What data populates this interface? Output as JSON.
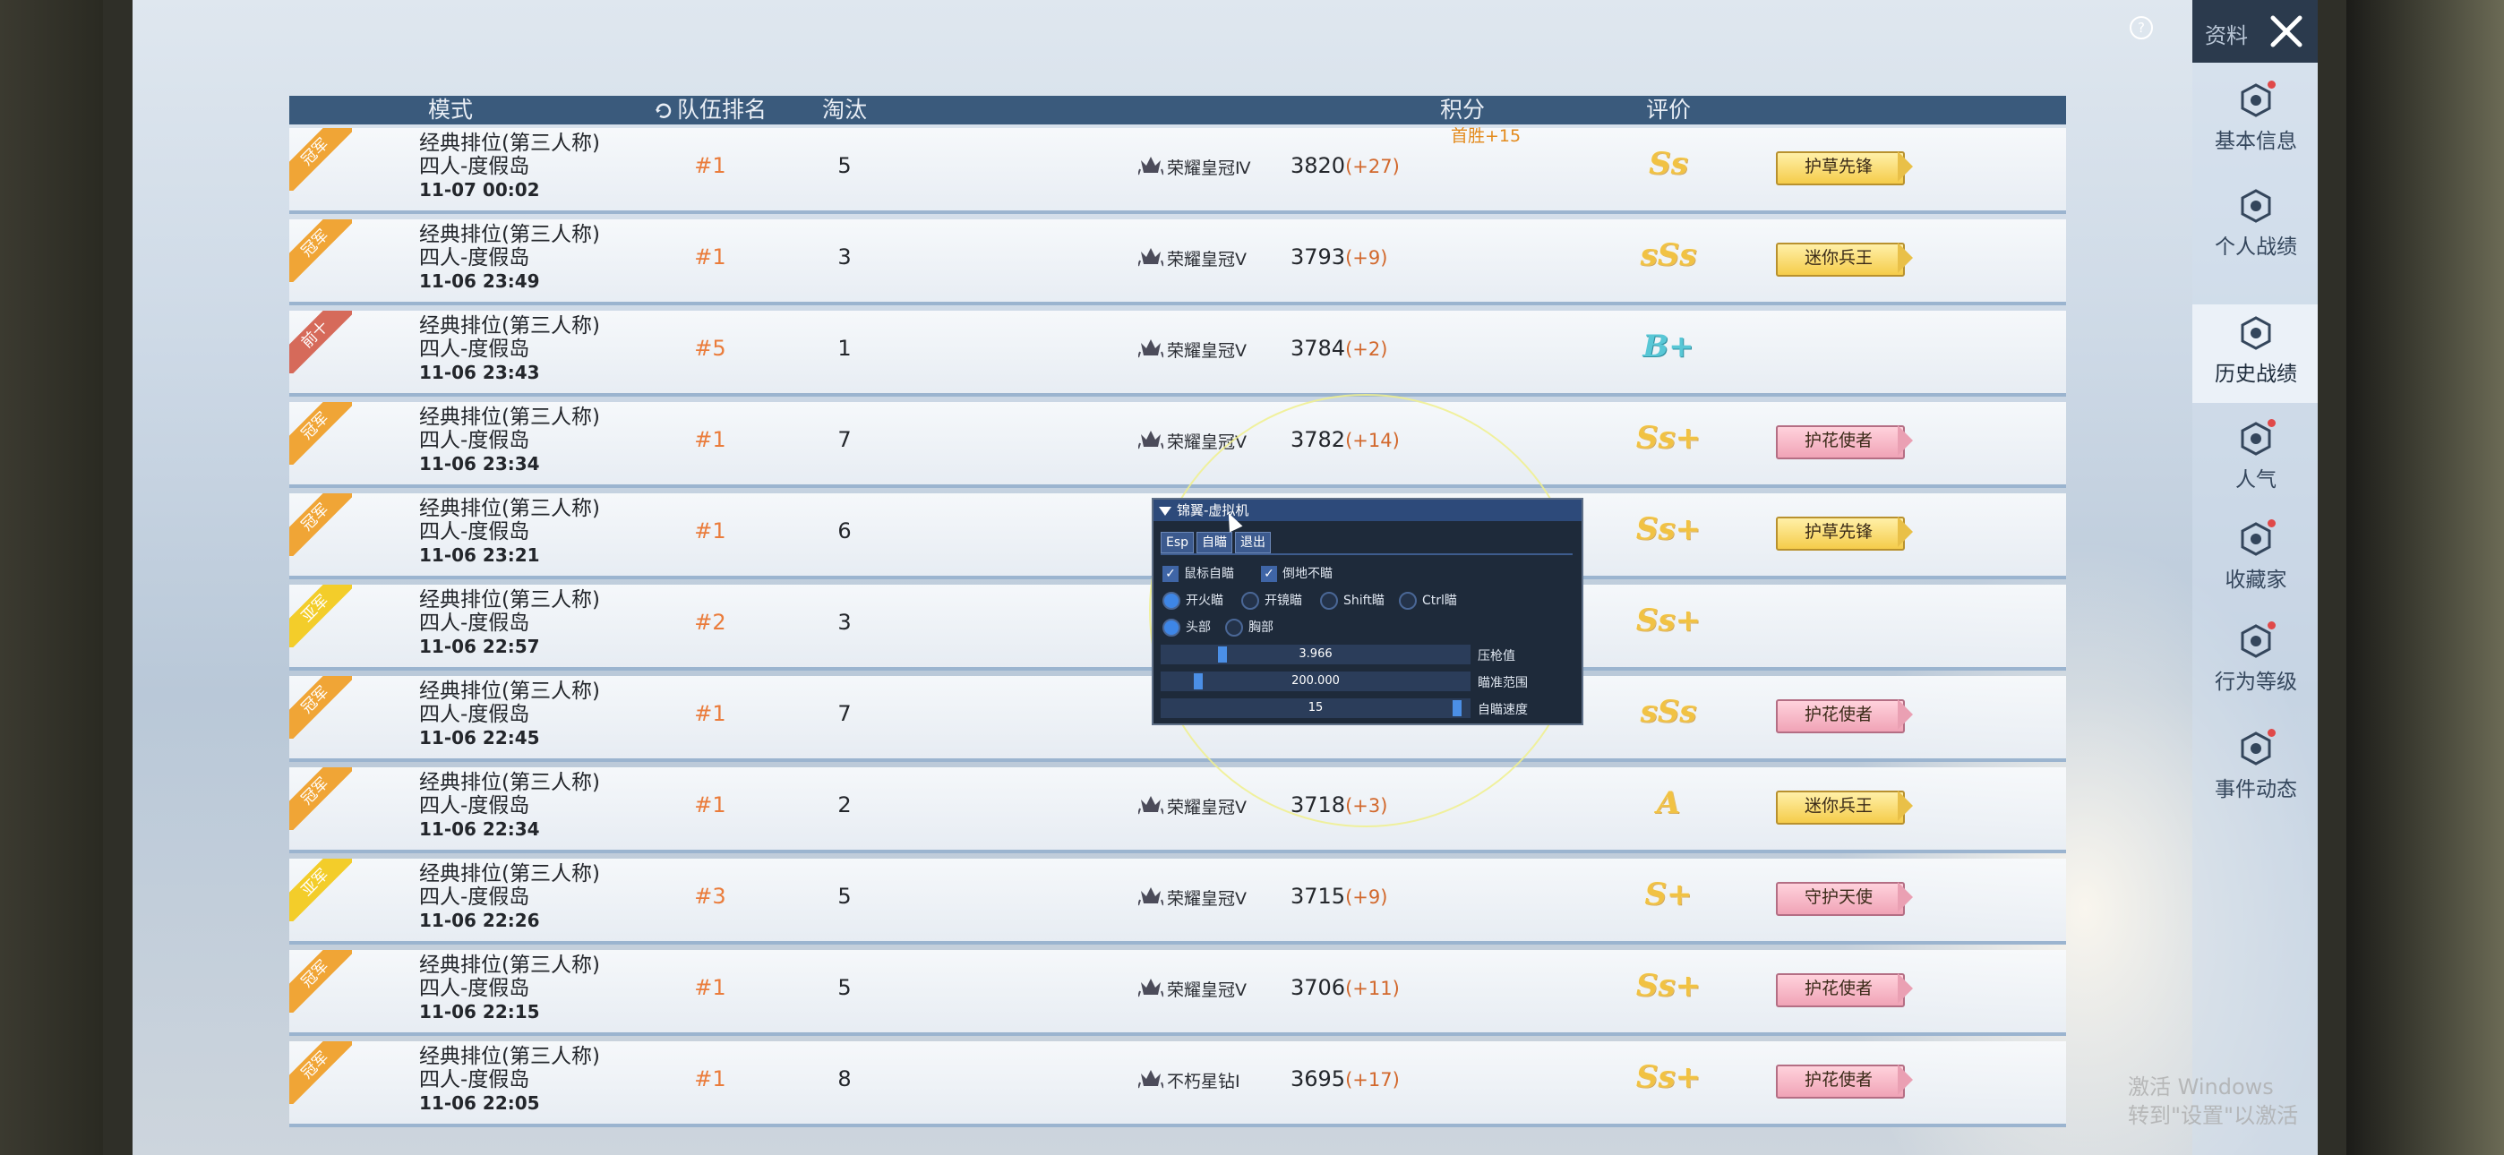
{
  "header": {
    "help": "?",
    "top_label": "资料",
    "columns": [
      "模式",
      "队伍排名",
      "淘汰",
      "积分",
      "评价"
    ]
  },
  "sidebar": {
    "items": [
      {
        "label": "基本信息",
        "icon": "hexagon-profile-icon",
        "dot": true
      },
      {
        "label": "个人战绩",
        "icon": "document-stats-icon",
        "dot": false
      },
      {
        "label": "历史战绩",
        "icon": "document-history-icon",
        "dot": false,
        "active": true
      },
      {
        "label": "人气",
        "icon": "popularity-icon",
        "dot": true
      },
      {
        "label": "收藏家",
        "icon": "collector-icon",
        "dot": true
      },
      {
        "label": "行为等级",
        "icon": "behavior-level-icon",
        "dot": true
      },
      {
        "label": "事件动态",
        "icon": "event-feed-icon",
        "dot": true
      }
    ]
  },
  "matches": [
    {
      "tag": "冠军",
      "mode": "经典排位(第三人称)",
      "map": "四人-度假岛",
      "date": "11-07 00:02",
      "rank": "#1",
      "kills": "5",
      "tier": "荣耀皇冠Ⅳ",
      "score": "3820",
      "delta": "(+27)",
      "grade": "Ss",
      "badge": "护草先锋",
      "first_win": "首胜+15"
    },
    {
      "tag": "冠军",
      "mode": "经典排位(第三人称)",
      "map": "四人-度假岛",
      "date": "11-06 23:49",
      "rank": "#1",
      "kills": "3",
      "tier": "荣耀皇冠Ⅴ",
      "score": "3793",
      "delta": "(+9)",
      "grade": "sSs",
      "badge": "迷你兵王"
    },
    {
      "tag": "前十",
      "mode": "经典排位(第三人称)",
      "map": "四人-度假岛",
      "date": "11-06 23:43",
      "rank": "#5",
      "kills": "1",
      "tier": "荣耀皇冠Ⅴ",
      "score": "3784",
      "delta": "(+2)",
      "grade": "B+",
      "badge": ""
    },
    {
      "tag": "冠军",
      "mode": "经典排位(第三人称)",
      "map": "四人-度假岛",
      "date": "11-06 23:34",
      "rank": "#1",
      "kills": "7",
      "tier": "荣耀皇冠Ⅴ",
      "score": "3782",
      "delta": "(+14)",
      "grade": "Ss+",
      "badge": "护花使者"
    },
    {
      "tag": "冠军",
      "mode": "经典排位(第三人称)",
      "map": "四人-度假岛",
      "date": "11-06 23:21",
      "rank": "#1",
      "kills": "6",
      "tier": "",
      "score": "",
      "delta": "",
      "grade": "Ss+",
      "badge": "护草先锋"
    },
    {
      "tag": "亚军",
      "mode": "经典排位(第三人称)",
      "map": "四人-度假岛",
      "date": "11-06 22:57",
      "rank": "#2",
      "kills": "3",
      "tier": "",
      "score": "",
      "delta": "",
      "grade": "Ss+",
      "badge": ""
    },
    {
      "tag": "冠军",
      "mode": "经典排位(第三人称)",
      "map": "四人-度假岛",
      "date": "11-06 22:45",
      "rank": "#1",
      "kills": "7",
      "tier": "",
      "score": "",
      "delta": "",
      "grade": "sSs",
      "badge": "护花使者"
    },
    {
      "tag": "冠军",
      "mode": "经典排位(第三人称)",
      "map": "四人-度假岛",
      "date": "11-06 22:34",
      "rank": "#1",
      "kills": "2",
      "tier": "荣耀皇冠Ⅴ",
      "score": "3718",
      "delta": "(+3)",
      "grade": "A",
      "badge": "迷你兵王"
    },
    {
      "tag": "亚军",
      "mode": "经典排位(第三人称)",
      "map": "四人-度假岛",
      "date": "11-06 22:26",
      "rank": "#3",
      "kills": "5",
      "tier": "荣耀皇冠Ⅴ",
      "score": "3715",
      "delta": "(+9)",
      "grade": "S+",
      "badge": "守护天使"
    },
    {
      "tag": "冠军",
      "mode": "经典排位(第三人称)",
      "map": "四人-度假岛",
      "date": "11-06 22:15",
      "rank": "#1",
      "kills": "5",
      "tier": "荣耀皇冠Ⅴ",
      "score": "3706",
      "delta": "(+11)",
      "grade": "Ss+",
      "badge": "护花使者"
    },
    {
      "tag": "冠军",
      "mode": "经典排位(第三人称)",
      "map": "四人-度假岛",
      "date": "11-06 22:05",
      "rank": "#1",
      "kills": "8",
      "tier": "不朽星钻Ⅰ",
      "score": "3695",
      "delta": "(+17)",
      "grade": "Ss+",
      "badge": "护花使者"
    }
  ],
  "overlay": {
    "title": "锦翼-虚拟机",
    "tabs": [
      "Esp",
      "自瞄",
      "退出"
    ],
    "checks": [
      "鼠标自瞄",
      "倒地不瞄"
    ],
    "radios_row1": [
      "开火瞄",
      "开镜瞄",
      "Shift瞄",
      "Ctrl瞄"
    ],
    "radios_row2": [
      "头部",
      "胸部"
    ],
    "sliders": [
      {
        "value": "3.966",
        "label": "压枪值",
        "fraction": 0.19
      },
      {
        "value": "200.000",
        "label": "瞄准范围",
        "fraction": 0.11
      },
      {
        "value": "15",
        "label": "自瞄速度",
        "fraction": 0.97
      }
    ]
  },
  "watermark": {
    "line1": "激活 Windows",
    "line2": "转到\"设置\"以激活"
  },
  "colors": {
    "header": "#3a5a7c",
    "rank": "#ea7c3b",
    "delta": "#d2682c"
  }
}
